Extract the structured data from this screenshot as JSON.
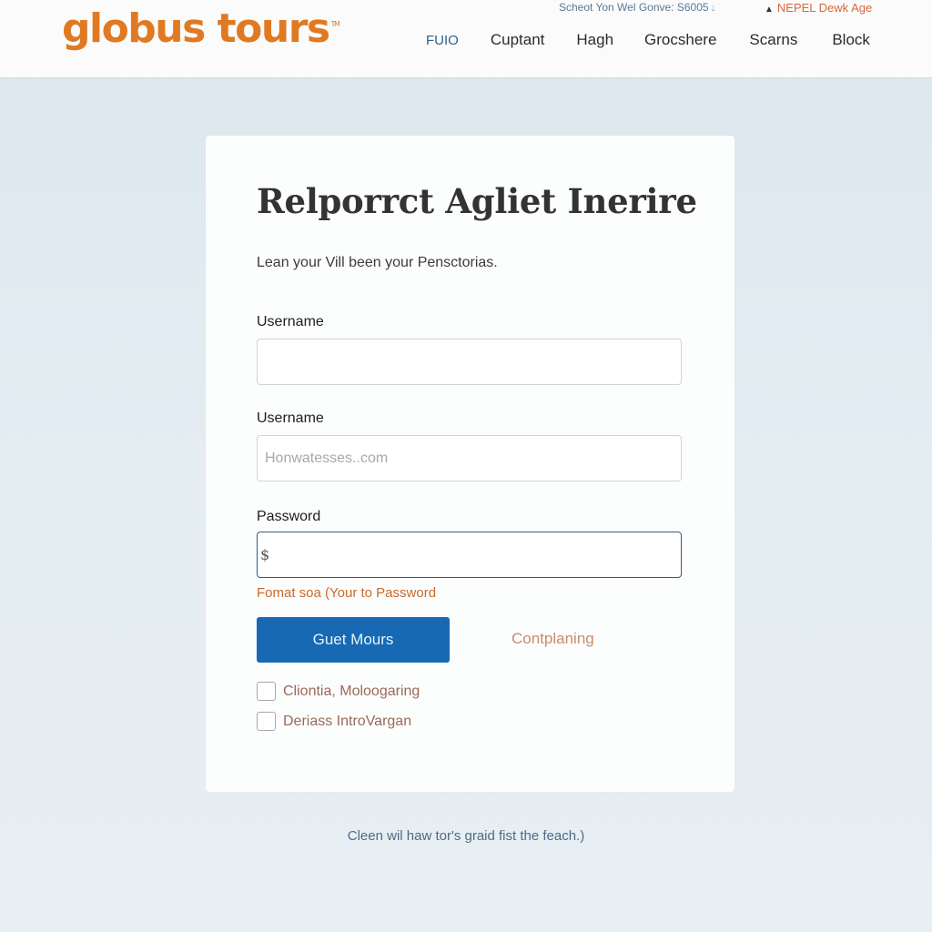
{
  "header": {
    "logo": "globus tours",
    "logo_tm": "TM",
    "topbar_left": "Scheot Yon Wel Gonve: S6005",
    "topbar_left_icon": "droplet-icon",
    "topbar_right": "NEPEL Dewk Age",
    "topbar_right_icon": "flame-icon",
    "nav": [
      {
        "label": "FUIO",
        "active": true
      },
      {
        "label": "Cuptant"
      },
      {
        "label": "Hagh"
      },
      {
        "label": "Grocshere"
      },
      {
        "label": "Scarns"
      },
      {
        "label": "Block"
      }
    ]
  },
  "form": {
    "title": "Relporrct Agliet Inerire",
    "subtitle": "Lean your Vill been your Pensctorias.",
    "field1": {
      "label": "Username",
      "value": "",
      "placeholder": ""
    },
    "field2": {
      "label": "Username",
      "value": "",
      "placeholder": "Honwatesses..com"
    },
    "password": {
      "label": "Password",
      "value": "$"
    },
    "hint": "Fomat soa (Your to Password",
    "primary_button": "Guet Mours",
    "secondary_link": "Contplaning",
    "checkboxes": [
      {
        "label": "Cliontia, Moloogaring",
        "checked": false
      },
      {
        "label": "Deriass IntroVargan",
        "checked": false
      }
    ]
  },
  "footer": {
    "note": "Cleen wil haw tor's graid fist the feach.)"
  },
  "colors": {
    "brand_orange": "#e07a22",
    "primary_blue": "#1769b4",
    "hint_orange": "#c9692a"
  }
}
